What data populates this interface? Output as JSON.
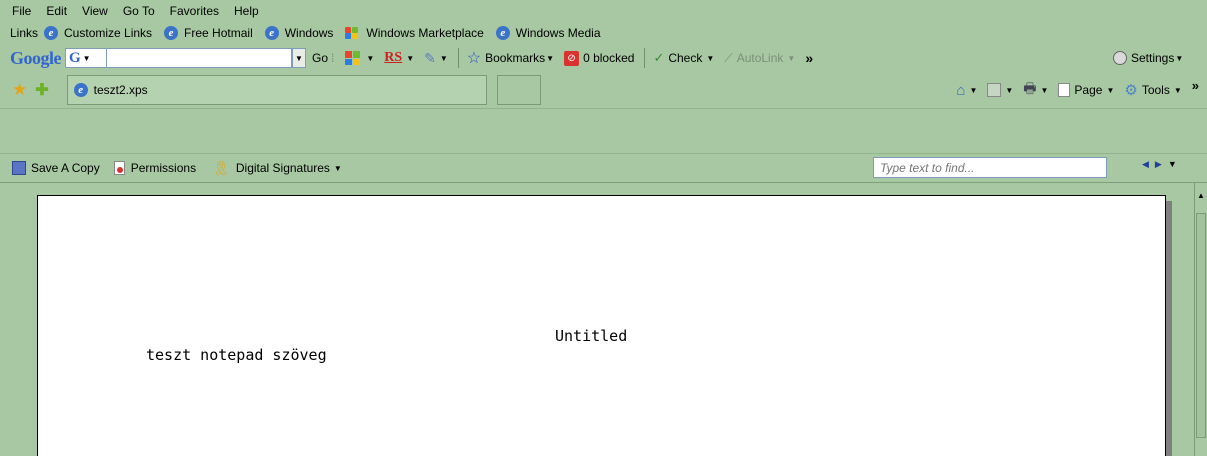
{
  "menu": [
    "File",
    "Edit",
    "View",
    "Go To",
    "Favorites",
    "Help"
  ],
  "links": {
    "label": "Links",
    "items": [
      "Customize Links",
      "Free Hotmail",
      "Windows",
      "Windows Marketplace",
      "Windows Media"
    ]
  },
  "google": {
    "logo": "Google",
    "menu_glyph": "G",
    "search_value": "",
    "go": "Go",
    "rs": "RS",
    "bookmarks": "Bookmarks",
    "blocked": "0 blocked",
    "check": "Check",
    "autolink": "AutoLink",
    "more": "»",
    "settings": "Settings"
  },
  "tabs": {
    "active_title": "teszt2.xps",
    "page_label": "Page",
    "tools_label": "Tools",
    "more": "»"
  },
  "doc_toolbar": {
    "save_copy": "Save A Copy",
    "permissions": "Permissions",
    "digital_signatures": "Digital Signatures",
    "find_placeholder": "Type text to find..."
  },
  "document": {
    "title": "Untitled",
    "body": "teszt notepad szöveg"
  },
  "colors": {
    "chrome_bg": "#a7c8a2",
    "page_bg": "#ffffff",
    "google_blue": "#3366cc"
  }
}
